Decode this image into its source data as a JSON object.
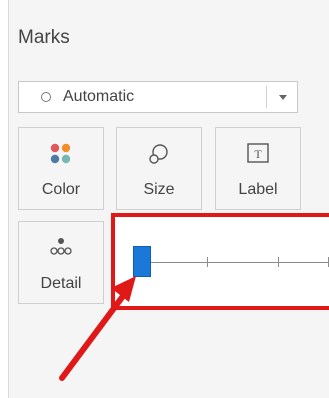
{
  "marks": {
    "title": "Marks",
    "mark_type": {
      "label": "Automatic",
      "icon": "circle-icon"
    },
    "cards": {
      "color": {
        "label": "Color",
        "icon": "color-dots-icon"
      },
      "size": {
        "label": "Size",
        "icon": "size-icon"
      },
      "label": {
        "label": "Label",
        "icon": "label-icon"
      },
      "detail": {
        "label": "Detail",
        "icon": "detail-dots-icon"
      }
    },
    "size_slider": {
      "level": 0.0,
      "ticks": 3
    }
  },
  "colors": {
    "accent_blue": "#1a78d8",
    "highlight_red": "#e01818",
    "color_dots": [
      "#e15759",
      "#f28e2b",
      "#4e79a7",
      "#76b7b2"
    ]
  }
}
